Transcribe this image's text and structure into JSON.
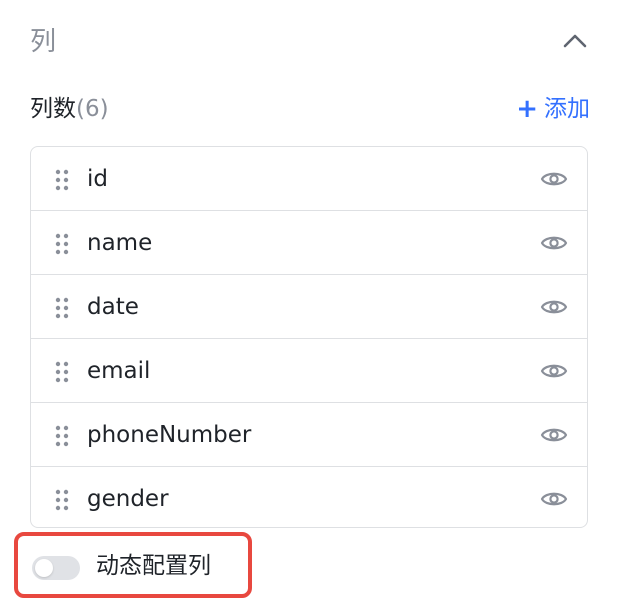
{
  "section": {
    "title": "列",
    "collapse_icon": "chevron-up-icon"
  },
  "columns_header": {
    "label": "列数",
    "count": "(6)",
    "add_plus": "+",
    "add_label": "添加"
  },
  "columns": [
    {
      "name": "id",
      "visible": true
    },
    {
      "name": "name",
      "visible": true
    },
    {
      "name": "date",
      "visible": true
    },
    {
      "name": "email",
      "visible": true
    },
    {
      "name": "phoneNumber",
      "visible": true
    },
    {
      "name": "gender",
      "visible": true
    }
  ],
  "dynamic_config": {
    "label": "动态配置列",
    "enabled": false,
    "highlight_color": "#e8483f"
  },
  "colors": {
    "accent": "#3370ff",
    "muted_text": "#8a8f99",
    "border": "#dee0e3",
    "toggle_off": "#e0e2e6"
  }
}
